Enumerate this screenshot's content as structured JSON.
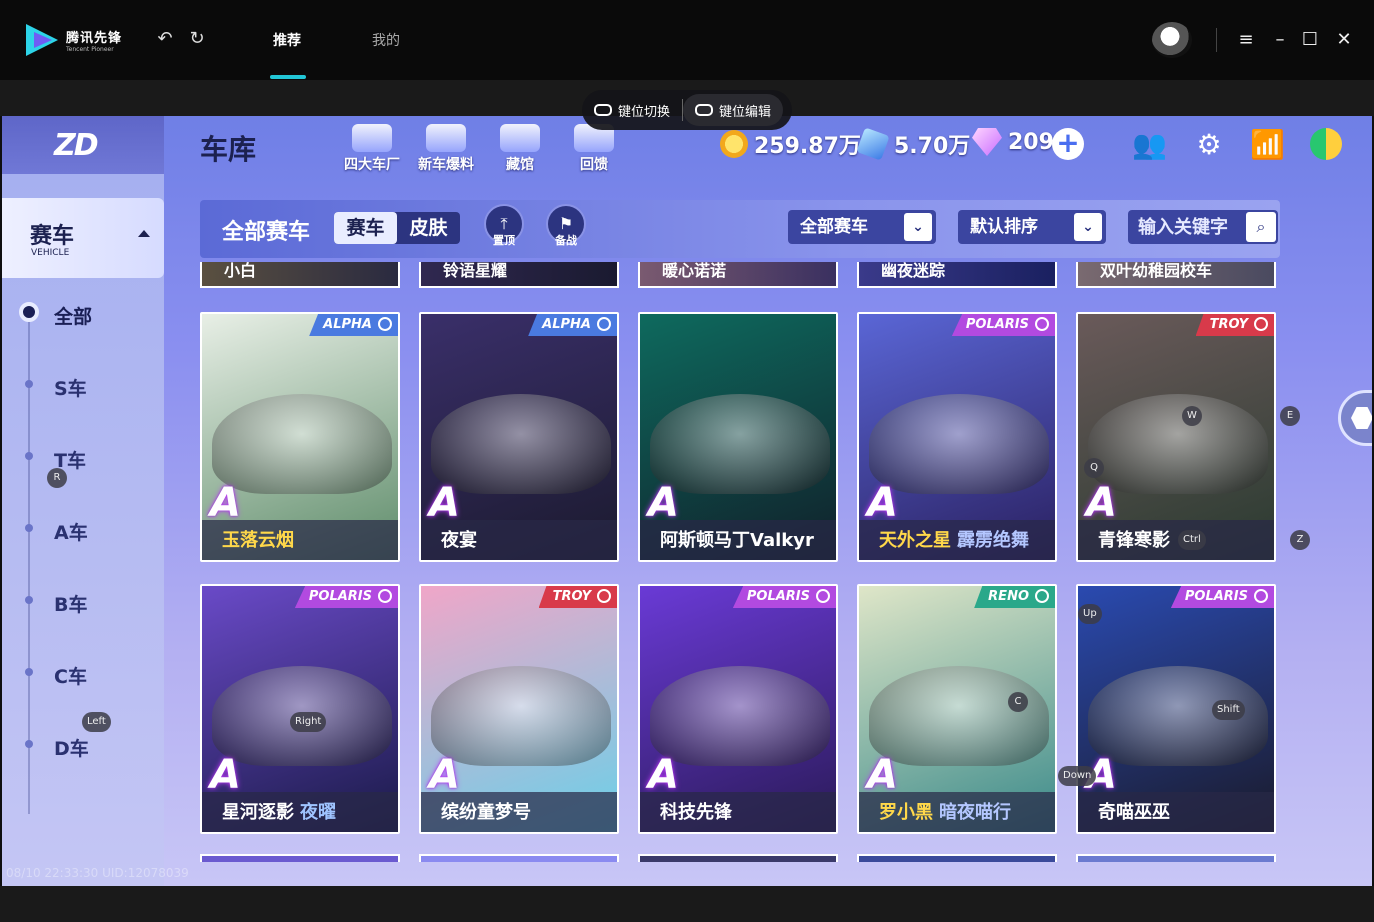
{
  "titlebar": {
    "logo_cn": "腾讯先锋",
    "logo_en": "Tencent Pioneer",
    "tabs": [
      {
        "label": "推荐",
        "active": true
      },
      {
        "label": "我的",
        "active": false
      }
    ],
    "icons": [
      "undo-icon",
      "refresh-icon",
      "menu-icon",
      "minimize-icon",
      "maximize-icon",
      "close-icon"
    ]
  },
  "keymap": {
    "switch_label": "键位切换",
    "edit_label": "键位编辑"
  },
  "game": {
    "page_title": "车库",
    "shop_buttons": [
      {
        "label": "四大车厂"
      },
      {
        "label": "新车爆料"
      },
      {
        "label": "藏馆"
      },
      {
        "label": "回馈"
      }
    ],
    "currency": {
      "coins": "259.87万",
      "tickets": "5.70万",
      "gems": "209"
    },
    "sidebar": {
      "category_title": "赛车",
      "category_sub": "VEHICLE",
      "items": [
        {
          "label": "全部",
          "active": true
        },
        {
          "label": "S车",
          "active": false
        },
        {
          "label": "T车",
          "active": false
        },
        {
          "label": "A车",
          "active": false
        },
        {
          "label": "B车",
          "active": false
        },
        {
          "label": "C车",
          "active": false
        },
        {
          "label": "D车",
          "active": false
        }
      ]
    },
    "filter": {
      "title": "全部赛车",
      "segments": [
        {
          "label": "赛车",
          "active": true
        },
        {
          "label": "皮肤",
          "active": false
        }
      ],
      "pin_label": "置顶",
      "backup_label": "备战",
      "dropdown_type": "全部赛车",
      "dropdown_sort": "默认排序",
      "search_placeholder": "输入关键字"
    },
    "partial_top": [
      "小白",
      "铃语星耀",
      "暖心诺诺",
      "幽夜迷踪",
      "双叶幼稚园校车"
    ],
    "cars_row1": [
      {
        "badge": "ALPHA",
        "grade": "A",
        "name": "玉落云烟",
        "sub": "",
        "gold": true,
        "color1": "#e8efe6",
        "color2": "#5e8c6a",
        "badgecolor": "#4a7ae0"
      },
      {
        "badge": "ALPHA",
        "grade": "A",
        "name": "夜宴",
        "sub": "",
        "gold": false,
        "color1": "#3a2f6a",
        "color2": "#1b1a2e",
        "badgecolor": "#4a7ae0"
      },
      {
        "badge": "",
        "grade": "A",
        "name": "阿斯顿马丁Valkyr",
        "sub": "",
        "gold": false,
        "color1": "#0e6a5e",
        "color2": "#10202a",
        "badgecolor": ""
      },
      {
        "badge": "POLARIS",
        "grade": "A",
        "name": "天外之星",
        "sub": "霹雳绝舞",
        "gold": true,
        "color1": "#5a66d6",
        "color2": "#2a2060",
        "badgecolor": "#b24ae0"
      },
      {
        "badge": "TROY",
        "grade": "A",
        "name": "青锋寒影",
        "sub": "",
        "gold": false,
        "color1": "#6a5a5a",
        "color2": "#2a3a30",
        "badgecolor": "#d83a4a"
      }
    ],
    "cars_row2": [
      {
        "badge": "POLARIS",
        "grade": "A",
        "name": "星河逐影",
        "sub": "夜曜",
        "gold": false,
        "color1": "#6a4ac8",
        "color2": "#1a1a48",
        "badgecolor": "#b24ae0"
      },
      {
        "badge": "TROY",
        "grade": "A",
        "name": "缤纷童梦号",
        "sub": "",
        "gold": false,
        "color1": "#f0a6c8",
        "color2": "#6ad0e8",
        "badgecolor": "#d83a4a"
      },
      {
        "badge": "POLARIS",
        "grade": "A",
        "name": "科技先锋",
        "sub": "",
        "gold": false,
        "color1": "#6a3ad6",
        "color2": "#2a1a58",
        "badgecolor": "#b24ae0"
      },
      {
        "badge": "RENO",
        "grade": "A",
        "name": "罗小黑",
        "sub": "暗夜喵行",
        "gold": true,
        "color1": "#dfe6c8",
        "color2": "#3a8a8a",
        "badgecolor": "#2aa88a"
      },
      {
        "badge": "POLARIS",
        "grade": "A",
        "name": "奇喵巫巫",
        "sub": "",
        "gold": false,
        "color1": "#2a4ab0",
        "color2": "#1a1a2a",
        "badgecolor": "#b24ae0"
      }
    ],
    "key_hints": {
      "r": "R",
      "w": "W",
      "q": "Q",
      "e": "E",
      "ctrl": "Ctrl",
      "z": "Z",
      "up": "Up",
      "right": "Right",
      "left": "Left",
      "c": "C",
      "shift": "Shift",
      "down": "Down"
    },
    "footer": "08/10 22:33:30 UID:12078039"
  }
}
